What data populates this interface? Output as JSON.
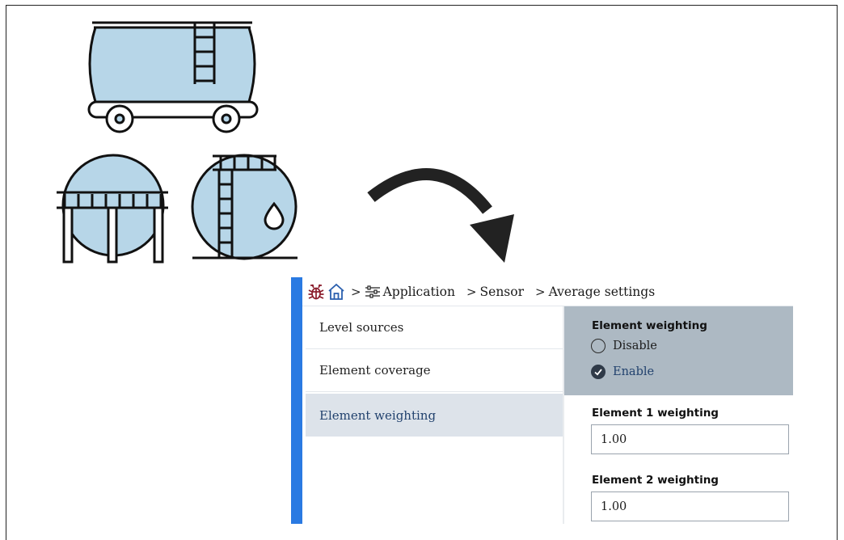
{
  "breadcrumb": {
    "items": [
      "Application",
      "Sensor",
      "Average settings"
    ],
    "separator": ">"
  },
  "navigation": {
    "items": [
      {
        "label": "Level sources"
      },
      {
        "label": "Element coverage"
      },
      {
        "label": "Element weighting"
      }
    ],
    "selected_index": 2
  },
  "panel": {
    "group_title": "Element weighting",
    "options": [
      {
        "label": "Disable",
        "selected": false
      },
      {
        "label": "Enable",
        "selected": true
      }
    ],
    "fields": [
      {
        "label": "Element 1 weighting",
        "value": "1.00"
      },
      {
        "label": "Element 2 weighting",
        "value": "1.00"
      }
    ]
  },
  "colors": {
    "accent": "#2a7ae2",
    "selected_nav_bg": "#dde3ea",
    "group_bg": "#adb9c3",
    "tank_fill": "#b7d6e8"
  },
  "icons": [
    "rail-tank-car-illustration",
    "spherical-tank-illustration",
    "horizontal-cylinder-tank-illustration",
    "curved-arrow-icon",
    "bug-icon",
    "home-icon",
    "sliders-icon",
    "checkmark-icon"
  ]
}
